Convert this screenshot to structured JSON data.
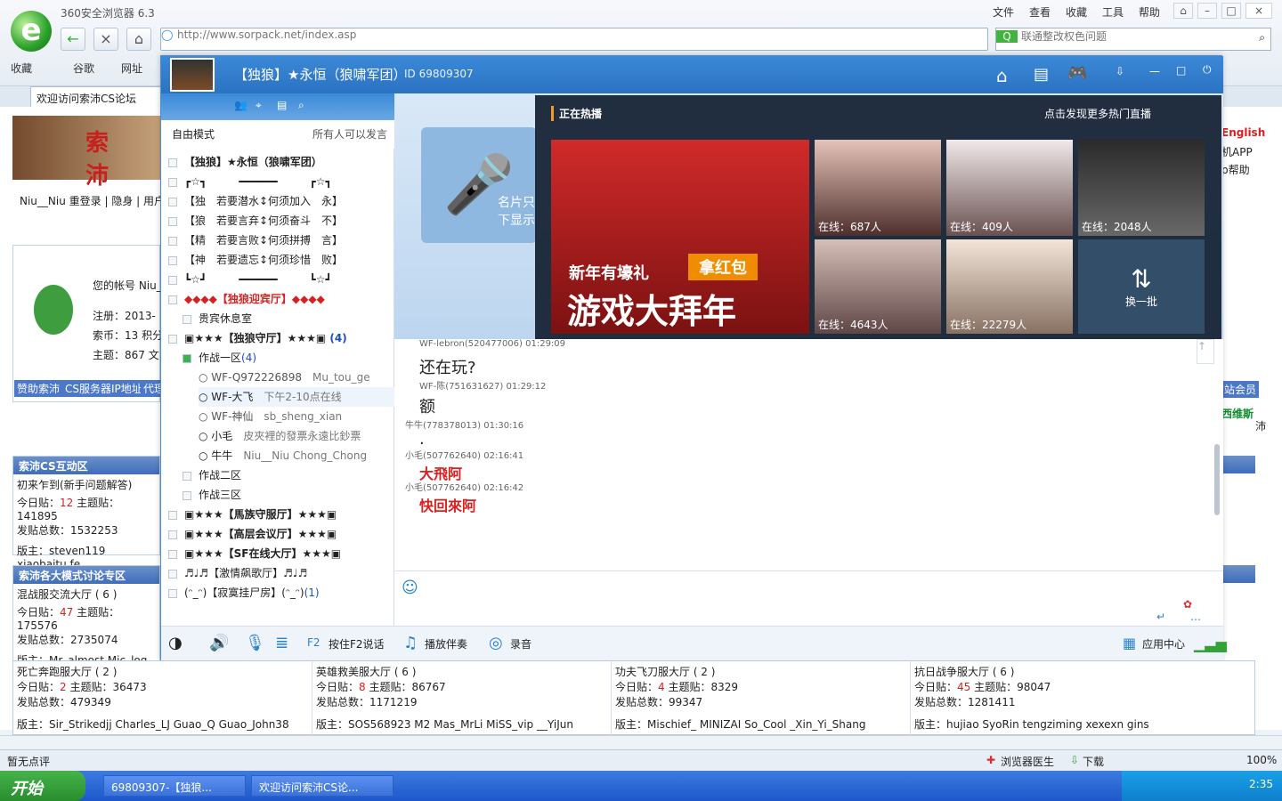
{
  "browser": {
    "title": "360安全浏览器 6.3",
    "menu": [
      "文件",
      "查看",
      "收藏",
      "工具",
      "帮助"
    ],
    "address": "http://www.sorpack.net/index.asp",
    "search_text": "联通整改权色问题",
    "bookmarks": [
      "收藏",
      "谷歌",
      "网址"
    ],
    "tab_title": "欢迎访问索沛CS论坛"
  },
  "forum": {
    "user_line": "Niu__Niu 重登录 | 隐身 | 用户",
    "account": "您的帐号 Niu_",
    "reg": "注册：2013-",
    "coin": "索币：13 积分",
    "topics": "主题：867 文",
    "links": [
      "赞助索沛",
      "CS服务器IP地址",
      "代理"
    ],
    "sec1": {
      "title": "索沛CS互动区",
      "board": "初来乍到(新手问题解答)",
      "today_label": "今日贴：",
      "today": "12",
      "topic_label": "主题贴：",
      "topic": "141895",
      "posts_label": "发贴总数：",
      "posts": "1532253",
      "mods": "版主：steven119 xiaobaitu fe"
    },
    "sec2": {
      "title": "索沛各大模式讨论专区",
      "board": "混战服交流大厅 ( 6 )",
      "today": "47",
      "topic": "175576",
      "posts": "2735074",
      "mods": "版主：Mr_almost Mic_log mar"
    },
    "right": [
      "English",
      "机APP",
      "p帮助",
      "站会员",
      "西维斯",
      "沛"
    ],
    "rows": [
      {
        "name": "死亡奔跑服大厅 ( 2 )",
        "today": "2",
        "topic": "36473",
        "posts": "479349",
        "mods": "版主：Sir_Strikedjj Charles_LJ Guao_Q Guao_John38"
      },
      {
        "name": "英雄救美服大厅 ( 6 )",
        "today": "8",
        "topic": "86767",
        "posts": "1171219",
        "mods": "版主：SOS568923 M2 Mas_MrLi MiSS_vip __YiJun"
      },
      {
        "name": "功夫飞刀服大厅 ( 2 )",
        "today": "4",
        "topic": "8329",
        "posts": "99347",
        "mods": "版主：Mischief_ MINIZAI So_Cool _Xin_Yi_Shang"
      },
      {
        "name": "抗日战争服大厅 ( 6 )",
        "today": "45",
        "topic": "98047",
        "posts": "1281411",
        "mods": "版主：hujiao SyoRin tengziming xexexn gins"
      }
    ]
  },
  "qq": {
    "group": "【独狼】★永恒（狼啸军团）",
    "id": "ID 69809307",
    "mode": "自由模式",
    "speak": "所有人可以发言",
    "list": [
      "【独狼】★永恒（狼啸军团）",
      "┏☆┓　　　━━━━━━　　　┏☆┓",
      "【独　若要潜水↕何须加入　永】",
      "【狼　若要言弃↕何须奋斗　不】",
      "【精　若要言败↕何须拼搏　言】",
      "【神　若要遗忘↕何须珍惜　败】",
      "┗☆┛　　　━━━━━━　　　┗☆┛",
      "◆◆◆◆【独狼迎宾厅】◆◆◆◆",
      "贵宾休息室",
      "▣★★★【独狼守厅】★★★▣",
      "作战一区",
      "WF-Q972226898",
      "WF-大飞",
      "WF-神仙",
      "小毛",
      "牛牛",
      "作战二区",
      "作战三区",
      "▣★★★【馬族守服厅】★★★▣",
      "▣★★★【高层会议厅】★★★▣",
      "▣★★★【SF在线大厅】★★★▣",
      "♬♩♬【激情飙歌厅】♬♩♬",
      "(ᵔ_ᵔ)【寂寞挂尸房】(ᵔ_ᵔ)"
    ],
    "counts": [
      "(4)",
      "(4)",
      "(1)"
    ],
    "members_note": [
      "Mu_tou_ge",
      "下午2-10点在线",
      "sb_sheng_xian",
      "皮夾裡的發票永遠比鈔票",
      "Niu__Niu  Chong_Chong"
    ],
    "chat": [
      {
        "who": "WF-lebron(520477006) 01:29:09",
        "msg": "还在玩?"
      },
      {
        "who": "WF-陈(751631627) 01:29:12",
        "msg": "额"
      },
      {
        "who": "牛牛(778378013) 01:30:16",
        "msg": "."
      },
      {
        "who": "小毛(507762640) 02:16:41",
        "msg": "大飛阿"
      },
      {
        "who": "小毛(507762640) 02:16:42",
        "msg": "快回來阿"
      }
    ],
    "live": {
      "title": "正在热播",
      "more": "点击发现更多热门直播",
      "banner1": "新年有壕礼",
      "banner2": "拿红包",
      "banner3": "游戏大拜年",
      "online": [
        "在线：687人",
        "在线：409人",
        "在线：2048人",
        "在线：4643人",
        "在线：22279人"
      ],
      "refresh": "换一批",
      "mic": "名片只下显示"
    },
    "bottom": [
      "按住F2说话",
      "播放伴奏",
      "录音",
      "应用中心"
    ]
  },
  "status": {
    "left": "暂无点评",
    "doctor": "浏览器医生",
    "download": "下载",
    "zoom": "100%"
  },
  "taskbar": {
    "start": "开始",
    "tasks": [
      "69809307-【独狼...",
      "欢迎访问索沛CS论..."
    ],
    "time": "2:35"
  }
}
